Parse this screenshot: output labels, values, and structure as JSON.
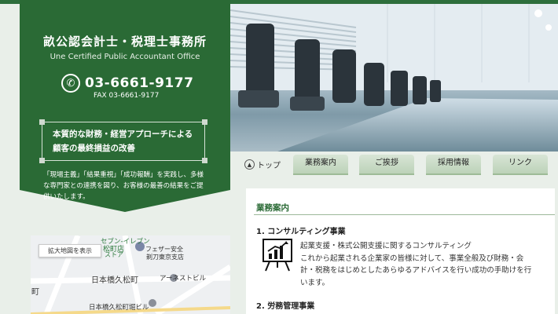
{
  "header": {
    "office_name": "畝公認会計士・税理士事務所",
    "office_name_en": "Une Certified Public Accountant Office",
    "phone": "03-6661-9177",
    "fax": "FAX 03-6661-9177"
  },
  "tagline": {
    "line1": "本質的な財務・経営アプローチによる",
    "line2": "顧客の最終損益の改善"
  },
  "description": "「現場主義」「結果重視」「成功報酬」を実践し、多様な専門家との連携を図り、お客様の最善の結果をご提供いたします。",
  "nav": {
    "home": "トップ",
    "items": [
      "業務案内",
      "ご挨拶",
      "採用情報",
      "リンク"
    ]
  },
  "main": {
    "section_title": "業務案内",
    "item1_title": "1. コンサルティング事業",
    "item1_line1": "起業支援・株式公開支援に関するコンサルティング",
    "item1_line2": "これから起業される企業家の皆様に対して、事業全般及び財務・会",
    "item1_line3": "計・税務をはじめとしたあらゆるアドバイスを行い成功の手助けを行",
    "item1_line4": "います。",
    "item2_title": "2. 労務管理事業"
  },
  "map": {
    "enlarge_button": "拡大地図を表示",
    "labels": {
      "store1": "セブン-イレブン",
      "store2": "松町店",
      "store3": "ストア",
      "bank1": "フェザー安全",
      "bank2": "剃刀東京支店",
      "area1": "日本橋久松町",
      "building1": "アーネストビル",
      "town_char": "町",
      "building2": "日本橋久松町堀ビル"
    }
  },
  "colors": {
    "brand_green": "#2a6a35",
    "nav_tab": "#c7dac4"
  }
}
